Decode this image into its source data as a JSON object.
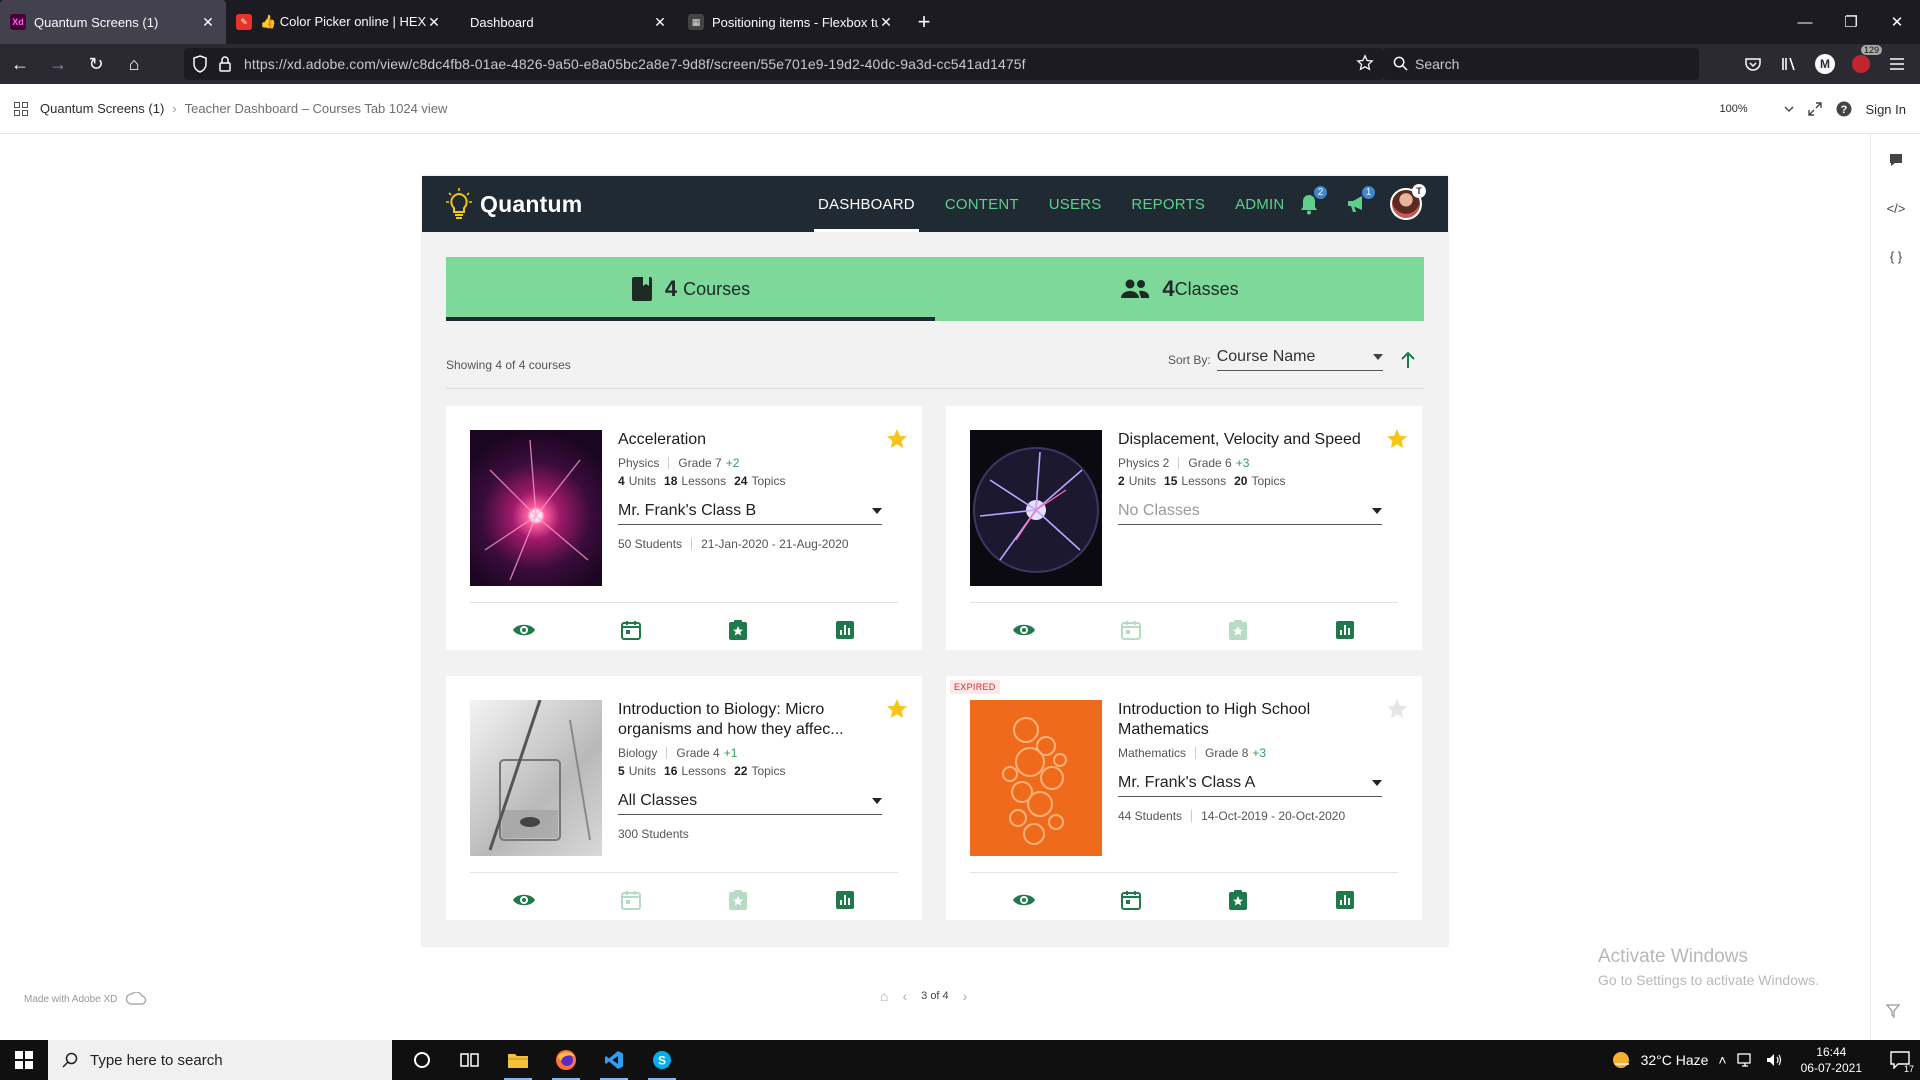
{
  "browser": {
    "tabs": [
      {
        "favicon": "Xd",
        "title": "Quantum Screens (1)",
        "active": true
      },
      {
        "favicon": "✎",
        "title": "👍 Color Picker online | HEX Co",
        "active": false
      },
      {
        "favicon": "",
        "title": "Dashboard",
        "active": false
      },
      {
        "favicon": "▦",
        "title": "Positioning items - Flexbox tuto",
        "active": false
      }
    ],
    "url": "https://xd.adobe.com/view/c8dc4fb8-01ae-4826-9a50-e8a05bc2a8e7-9d8f/screen/55e701e9-19d2-40dc-9a3d-cc541ad1475f",
    "search_placeholder": "Search",
    "account_initial": "M",
    "extension_badge": "129"
  },
  "xd": {
    "breadcrumb_project": "Quantum Screens (1)",
    "breadcrumb_screen": "Teacher Dashboard – Courses Tab 1024 view",
    "zoom": "100%",
    "signin": "Sign In"
  },
  "app": {
    "brand": "Quantum",
    "menu": [
      "DASHBOARD",
      "CONTENT",
      "USERS",
      "REPORTS",
      "ADMIN"
    ],
    "notif_count": "2",
    "announce_count": "1",
    "avatar_badge": "T",
    "tabs": {
      "courses_count": "4",
      "courses_label": "Courses",
      "classes_count": "4",
      "classes_label": "Classes"
    },
    "showing": "Showing 4 of 4 courses",
    "sort_label": "Sort By:",
    "sort_value": "Course Name",
    "courses": [
      {
        "title": "Acceleration",
        "subject": "Physics",
        "grade": "Grade 7",
        "grade_plus": "+2",
        "units": "4",
        "units_label": "Units",
        "lessons": "18",
        "lessons_label": "Lessons",
        "topics": "24",
        "topics_label": "Topics",
        "class": "Mr. Frank's Class B",
        "students": "50 Students",
        "dates": "21-Jan-2020 - 21-Aug-2020",
        "starred": true,
        "expired": ""
      },
      {
        "title": "Displacement, Velocity and Speed",
        "subject": "Physics 2",
        "grade": "Grade 6",
        "grade_plus": "+3",
        "units": "2",
        "units_label": "Units",
        "lessons": "15",
        "lessons_label": "Lessons",
        "topics": "20",
        "topics_label": "Topics",
        "class": "No Classes",
        "students": "",
        "dates": "",
        "starred": true,
        "expired": ""
      },
      {
        "title": "Introduction to Biology: Micro organisms and how they affec...",
        "subject": "Biology",
        "grade": "Grade 4",
        "grade_plus": "+1",
        "units": "5",
        "units_label": "Units",
        "lessons": "16",
        "lessons_label": "Lessons",
        "topics": "22",
        "topics_label": "Topics",
        "class": "All Classes",
        "students": "300 Students",
        "dates": "",
        "starred": true,
        "expired": ""
      },
      {
        "title": "Introduction to High School Mathematics",
        "subject": "Mathematics",
        "grade": "Grade 8",
        "grade_plus": "+3",
        "units": "",
        "units_label": "",
        "lessons": "",
        "lessons_label": "",
        "topics": "",
        "topics_label": "",
        "class": "Mr. Frank's Class A",
        "students": "44 Students",
        "dates": "14-Oct-2019 - 20-Oct-2020",
        "starred": false,
        "expired": "EXPIRED"
      }
    ]
  },
  "footer": {
    "made_with": "Made with Adobe XD",
    "pager": "3 of 4",
    "activate_title": "Activate Windows",
    "activate_sub": "Go to Settings to activate Windows."
  },
  "taskbar": {
    "search_placeholder": "Type here to search",
    "weather": "32°C  Haze",
    "time": "16:44",
    "date": "06-07-2021",
    "notif_count": "17"
  },
  "colors": {
    "accent": "#7dd89a",
    "nav": "#1f2a33",
    "brand_green": "#1e7a4a",
    "star": "#f5c518"
  }
}
